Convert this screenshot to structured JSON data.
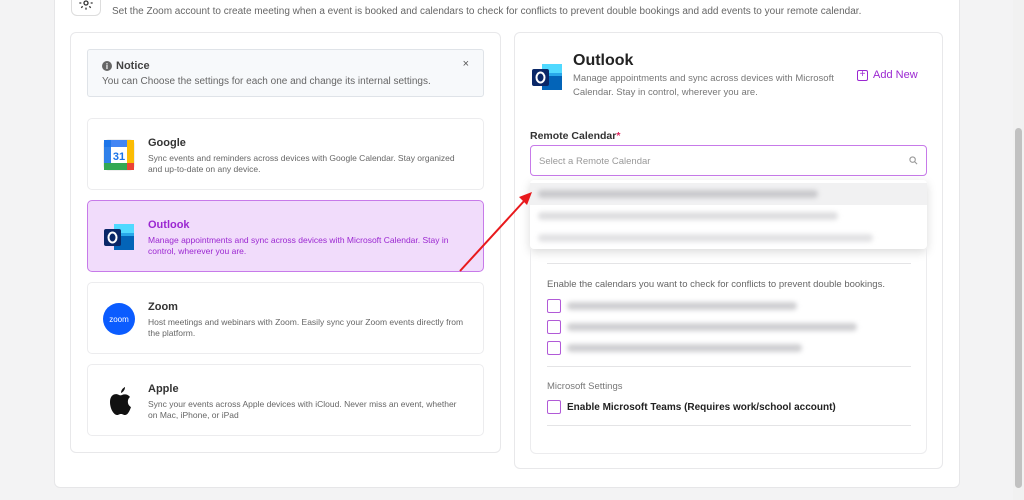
{
  "header": {
    "description": "Set the Zoom account to create meeting when a event is booked and calendars to check for conflicts to prevent double bookings and add events to your remote calendar.",
    "icon": "gear-icon"
  },
  "notice": {
    "title": "Notice",
    "text": "You can Choose the settings for each one and change its internal settings.",
    "close": "×"
  },
  "providers": [
    {
      "title": "Google",
      "desc": "Sync events and reminders across devices with Google Calendar. Stay organized and up-to-date on any device.",
      "icon": "google-calendar-icon",
      "active": false
    },
    {
      "title": "Outlook",
      "desc": "Manage appointments and sync across devices with Microsoft Calendar. Stay in control, wherever you are.",
      "icon": "outlook-icon",
      "active": true
    },
    {
      "title": "Zoom",
      "desc": "Host meetings and webinars with Zoom. Easily sync your Zoom events directly from the platform.",
      "icon": "zoom-icon",
      "active": false
    },
    {
      "title": "Apple",
      "desc": "Sync your events across Apple devices with iCloud. Never miss an event, whether on Mac, iPhone, or iPad",
      "icon": "apple-icon",
      "active": false
    }
  ],
  "detail": {
    "title": "Outlook",
    "desc": "Manage appointments and sync across devices with Microsoft Calendar. Stay in control, wherever you are.",
    "add_new": "Add New",
    "remote_calendar_label": "Remote Calendar",
    "required_mark": "*",
    "remote_calendar_placeholder": "Select a Remote Calendar",
    "conflicts_text": "Enable the calendars you want to check for conflicts to prevent double bookings.",
    "ms_settings_label": "Microsoft Settings",
    "teams_label": "Enable Microsoft Teams (Requires work/school account)"
  },
  "colors": {
    "accent": "#9b27d1",
    "active_bg": "#f1dcfb",
    "arrow": "#e8191c"
  }
}
